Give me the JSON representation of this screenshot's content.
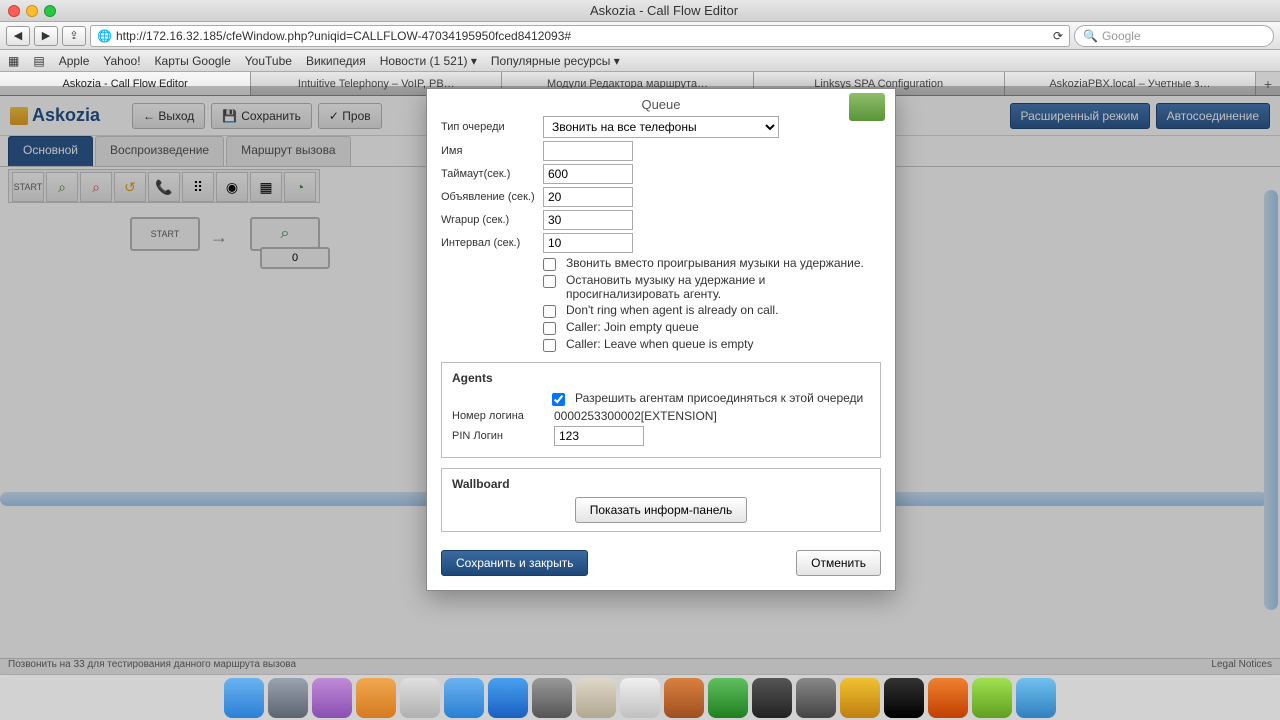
{
  "window": {
    "title": "Askozia - Call Flow Editor"
  },
  "url": "http://172.16.32.185/cfeWindow.php?uniqid=CALLFLOW-47034195950fced8412093#",
  "search_placeholder": "Google",
  "bookmarks": [
    "Apple",
    "Yahoo!",
    "Карты Google",
    "YouTube",
    "Википедия",
    "Новости (1 521) ▾",
    "Популярные ресурсы ▾"
  ],
  "tabs": [
    "Askozia - Call Flow Editor",
    "Intuitive Telephony – VoIP, PB…",
    "Модули Редактора маршрута…",
    "Linksys SPA Configuration",
    "AskoziaPBX.local – Учетные з…"
  ],
  "app": {
    "logo": "Askozia",
    "buttons": {
      "exit": "← Выход",
      "save": "Сохранить",
      "check": "✓ Пров",
      "advanced": "Расширенный режим",
      "autoconnect": "Автосоединение"
    },
    "tabs2": [
      "Основной",
      "Воспроизведение",
      "Маршрут вызова"
    ],
    "start_label": "START",
    "canvas_start": "START",
    "canvas_val": "0",
    "footer_left": "Позвонить на 33 для тестирования данного маршрута вызова",
    "footer_right": "Legal Notices"
  },
  "modal": {
    "title": "Queue",
    "labels": {
      "queue_type": "Тип очереди",
      "name": "Имя",
      "timeout": "Таймаут(сек.)",
      "announce": "Объявление (сек.)",
      "wrapup": "Wrapup (сек.)",
      "interval": "Интервал (сек.)",
      "login_num": "Номер логина",
      "pin": "PIN Логин"
    },
    "values": {
      "queue_type": "Звонить на все телефоны",
      "name": "",
      "timeout": "600",
      "announce": "20",
      "wrapup": "30",
      "interval": "10",
      "login_num": "0000253300002[EXTENSION]",
      "pin": "123"
    },
    "checks": [
      "Звонить вместо проигрывания музыки на удержание.",
      "Остановить музыку на удержание и просигнализировать агенту.",
      "Don't ring when agent is already on call.",
      "Caller: Join empty queue",
      "Caller: Leave when queue is empty"
    ],
    "agents_title": "Agents",
    "agents_check": "Разрешить агентам присоединяться к этой очереди",
    "wallboard_title": "Wallboard",
    "wallboard_btn": "Показать информ-панель",
    "save_close": "Сохранить и закрыть",
    "cancel": "Отменить"
  }
}
